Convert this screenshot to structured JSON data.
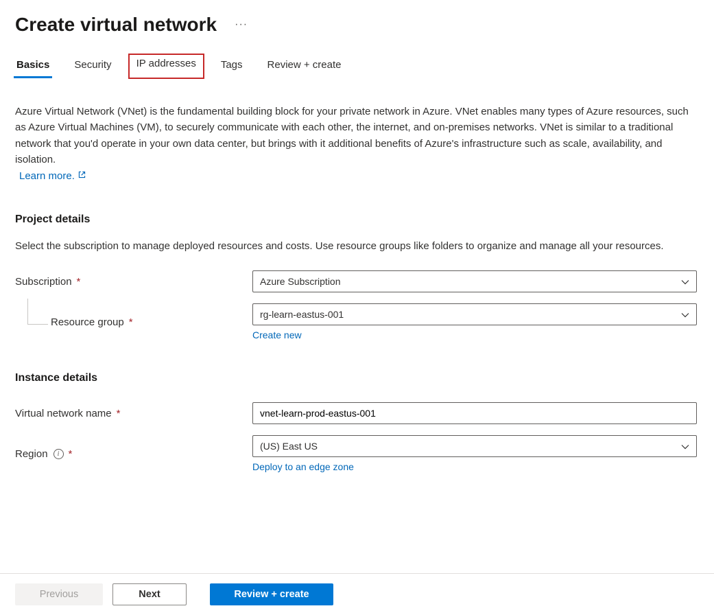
{
  "header": {
    "title": "Create virtual network"
  },
  "tabs": {
    "basics": "Basics",
    "security": "Security",
    "ip": "IP addresses",
    "tags": "Tags",
    "review": "Review + create"
  },
  "intro": {
    "text": "Azure Virtual Network (VNet) is the fundamental building block for your private network in Azure. VNet enables many types of Azure resources, such as Azure Virtual Machines (VM), to securely communicate with each other, the internet, and on-premises networks. VNet is similar to a traditional network that you'd operate in your own data center, but brings with it additional benefits of Azure's infrastructure such as scale, availability, and isolation.",
    "learnMore": "Learn more."
  },
  "project": {
    "heading": "Project details",
    "sub": "Select the subscription to manage deployed resources and costs. Use resource groups like folders to organize and manage all your resources.",
    "subscriptionLabel": "Subscription",
    "subscriptionValue": "Azure Subscription",
    "resourceGroupLabel": "Resource group",
    "resourceGroupValue": "rg-learn-eastus-001",
    "createNew": "Create new"
  },
  "instance": {
    "heading": "Instance details",
    "nameLabel": "Virtual network name",
    "nameValue": "vnet-learn-prod-eastus-001",
    "regionLabel": "Region",
    "regionValue": "(US) East US",
    "deployEdge": "Deploy to an edge zone"
  },
  "footer": {
    "previous": "Previous",
    "next": "Next",
    "review": "Review + create"
  }
}
